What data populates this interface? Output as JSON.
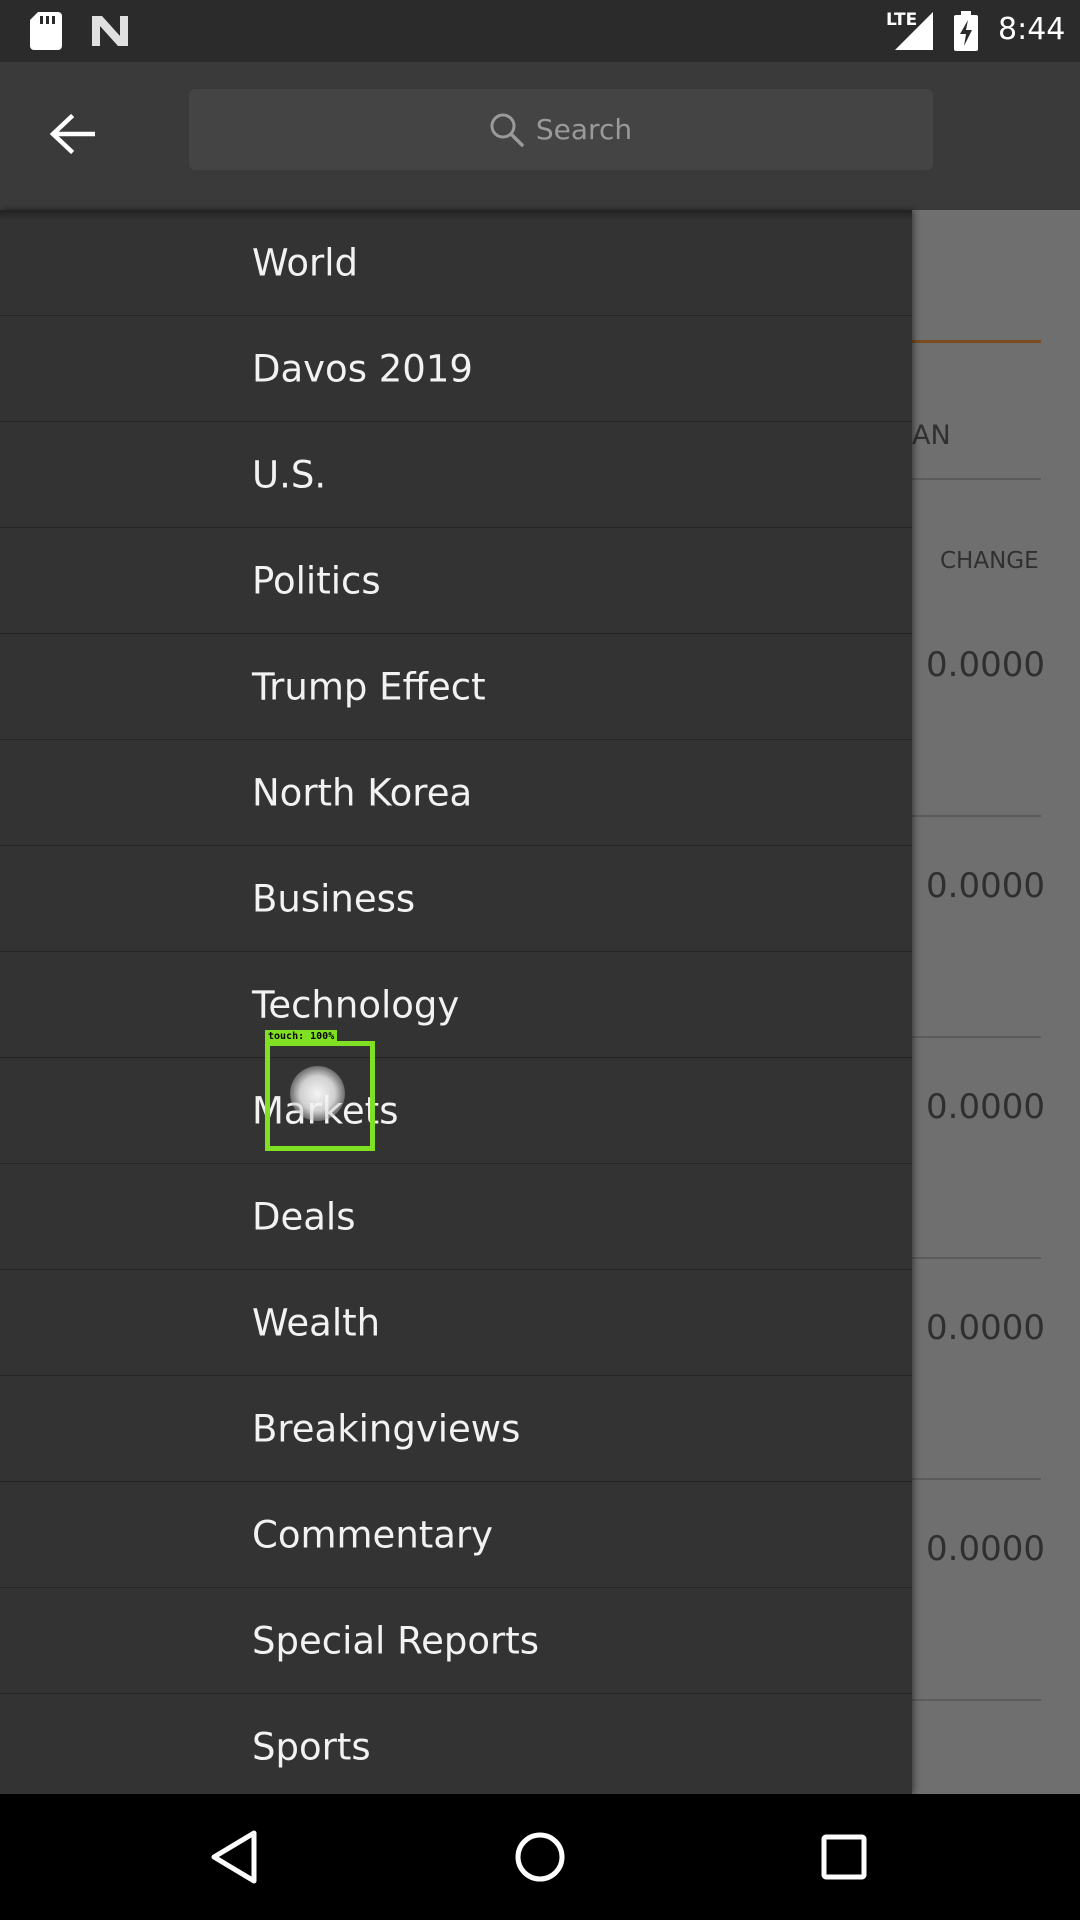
{
  "status_bar": {
    "network": "LTE",
    "time": "8:44",
    "icons": [
      "sd-card-icon",
      "n-logo-icon",
      "signal-icon",
      "battery-charging-icon"
    ]
  },
  "toolbar": {
    "back_icon": "arrow-left-icon",
    "search_placeholder": "Search",
    "search_icon": "search-icon"
  },
  "drawer": {
    "items": [
      {
        "label": "World"
      },
      {
        "label": "Davos 2019"
      },
      {
        "label": "U.S."
      },
      {
        "label": "Politics"
      },
      {
        "label": "Trump Effect"
      },
      {
        "label": "North Korea"
      },
      {
        "label": "Business"
      },
      {
        "label": "Technology"
      },
      {
        "label": "Markets"
      },
      {
        "label": "Deals"
      },
      {
        "label": "Wealth"
      },
      {
        "label": "Breakingviews"
      },
      {
        "label": "Commentary"
      },
      {
        "label": "Special Reports"
      },
      {
        "label": "Sports"
      }
    ]
  },
  "background": {
    "tab_fragment": "AN",
    "column_header": "CHANGE",
    "values": [
      "0.0000",
      "0.0000",
      "0.0000",
      "0.0000",
      "0.0000"
    ],
    "accent_color": "#7a4a20"
  },
  "touch_overlay": {
    "label": "touch: 100%",
    "color": "#7fe024"
  },
  "nav_bar": {
    "buttons": [
      "back-triangle-icon",
      "home-circle-icon",
      "recents-square-icon"
    ]
  }
}
